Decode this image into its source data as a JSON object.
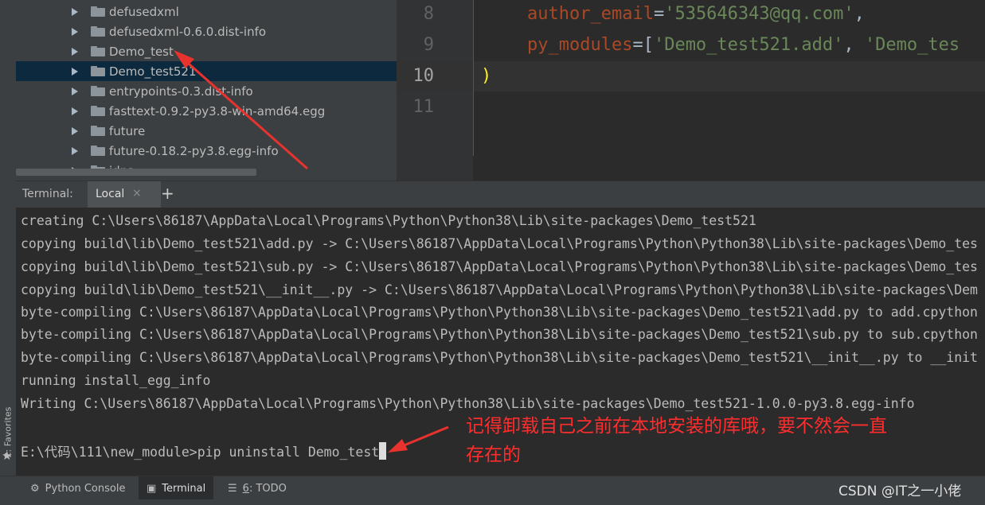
{
  "project_tree": {
    "items": [
      {
        "label": "defusedxml"
      },
      {
        "label": "defusedxml-0.6.0.dist-info"
      },
      {
        "label": "Demo_test"
      },
      {
        "label": "Demo_test521",
        "selected": true
      },
      {
        "label": "entrypoints-0.3.dist-info"
      },
      {
        "label": "fasttext-0.9.2-py3.8-win-amd64.egg"
      },
      {
        "label": "future"
      },
      {
        "label": "future-0.18.2-py3.8.egg-info"
      },
      {
        "label": "idna"
      }
    ]
  },
  "editor": {
    "line_numbers": [
      "8",
      "9",
      "10",
      "11"
    ],
    "current_line": "10",
    "line8": {
      "param": "author_email",
      "eq": "=",
      "value": "'535646343@qq.com'",
      "tail": ","
    },
    "line9": {
      "param": "py_modules",
      "eq": "=",
      "open": "[",
      "value1": "'Demo_test521.add'",
      "sep": ", ",
      "value2": "'Demo_tes"
    },
    "line10": ")"
  },
  "terminal_header": {
    "label": "Terminal:",
    "tab": "Local",
    "close": "×",
    "add": "+"
  },
  "terminal": {
    "lines": [
      "creating C:\\Users\\86187\\AppData\\Local\\Programs\\Python\\Python38\\Lib\\site-packages\\Demo_test521",
      "copying build\\lib\\Demo_test521\\add.py -> C:\\Users\\86187\\AppData\\Local\\Programs\\Python\\Python38\\Lib\\site-packages\\Demo_tes",
      "copying build\\lib\\Demo_test521\\sub.py -> C:\\Users\\86187\\AppData\\Local\\Programs\\Python\\Python38\\Lib\\site-packages\\Demo_tes",
      "copying build\\lib\\Demo_test521\\__init__.py -> C:\\Users\\86187\\AppData\\Local\\Programs\\Python\\Python38\\Lib\\site-packages\\Dem",
      "byte-compiling C:\\Users\\86187\\AppData\\Local\\Programs\\Python\\Python38\\Lib\\site-packages\\Demo_test521\\add.py to add.cpython",
      "byte-compiling C:\\Users\\86187\\AppData\\Local\\Programs\\Python\\Python38\\Lib\\site-packages\\Demo_test521\\sub.py to sub.cpython",
      "byte-compiling C:\\Users\\86187\\AppData\\Local\\Programs\\Python\\Python38\\Lib\\site-packages\\Demo_test521\\__init__.py to __init",
      "running install_egg_info",
      "Writing C:\\Users\\86187\\AppData\\Local\\Programs\\Python\\Python38\\Lib\\site-packages\\Demo_test521-1.0.0-py3.8.egg-info"
    ],
    "prompt": "E:\\代码\\111\\new_module>pip uninstall Demo_test"
  },
  "annotation": {
    "line1": "记得卸载自己之前在本地安装的库哦，要不然会一直",
    "line2": "存在的"
  },
  "left_strip": {
    "favorites": "2: Favorites"
  },
  "bottom_bar": {
    "python_console": "Python Console",
    "terminal": "Terminal",
    "todo_mnemonic": "6",
    "todo_rest": ": TODO"
  },
  "watermark": "CSDN @IT之一小佬",
  "colors": {
    "annotation": "#ff2d2d",
    "selection": "#0d293e",
    "string": "#6a8759",
    "param": "#aa4926"
  }
}
